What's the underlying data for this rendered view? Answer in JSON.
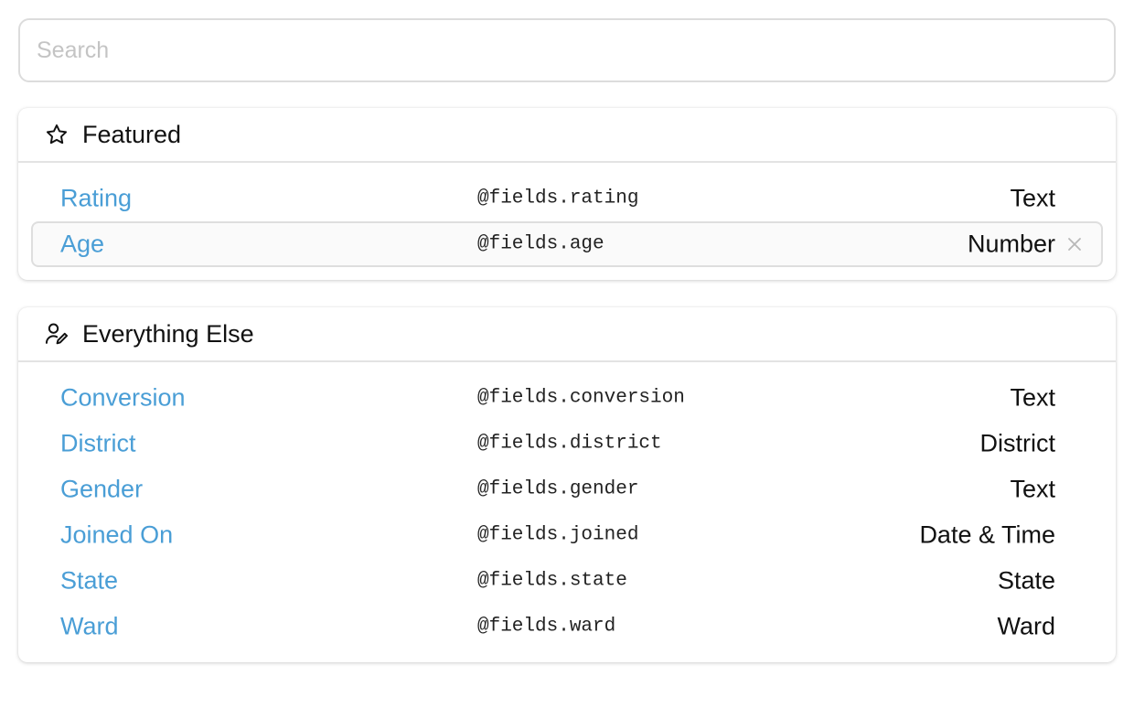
{
  "search": {
    "placeholder": "Search",
    "value": ""
  },
  "sections": [
    {
      "title": "Featured",
      "icon": "star-icon",
      "rows": [
        {
          "label": "Rating",
          "key": "@fields.rating",
          "type": "Text"
        },
        {
          "label": "Age",
          "key": "@fields.age",
          "type": "Number",
          "selected": true
        }
      ]
    },
    {
      "title": "Everything Else",
      "icon": "user-edit-icon",
      "rows": [
        {
          "label": "Conversion",
          "key": "@fields.conversion",
          "type": "Text"
        },
        {
          "label": "District",
          "key": "@fields.district",
          "type": "District"
        },
        {
          "label": "Gender",
          "key": "@fields.gender",
          "type": "Text"
        },
        {
          "label": "Joined On",
          "key": "@fields.joined",
          "type": "Date & Time"
        },
        {
          "label": "State",
          "key": "@fields.state",
          "type": "State"
        },
        {
          "label": "Ward",
          "key": "@fields.ward",
          "type": "Ward"
        }
      ]
    }
  ],
  "colors": {
    "link": "#4a9ed6",
    "border": "#dcdcdc"
  }
}
